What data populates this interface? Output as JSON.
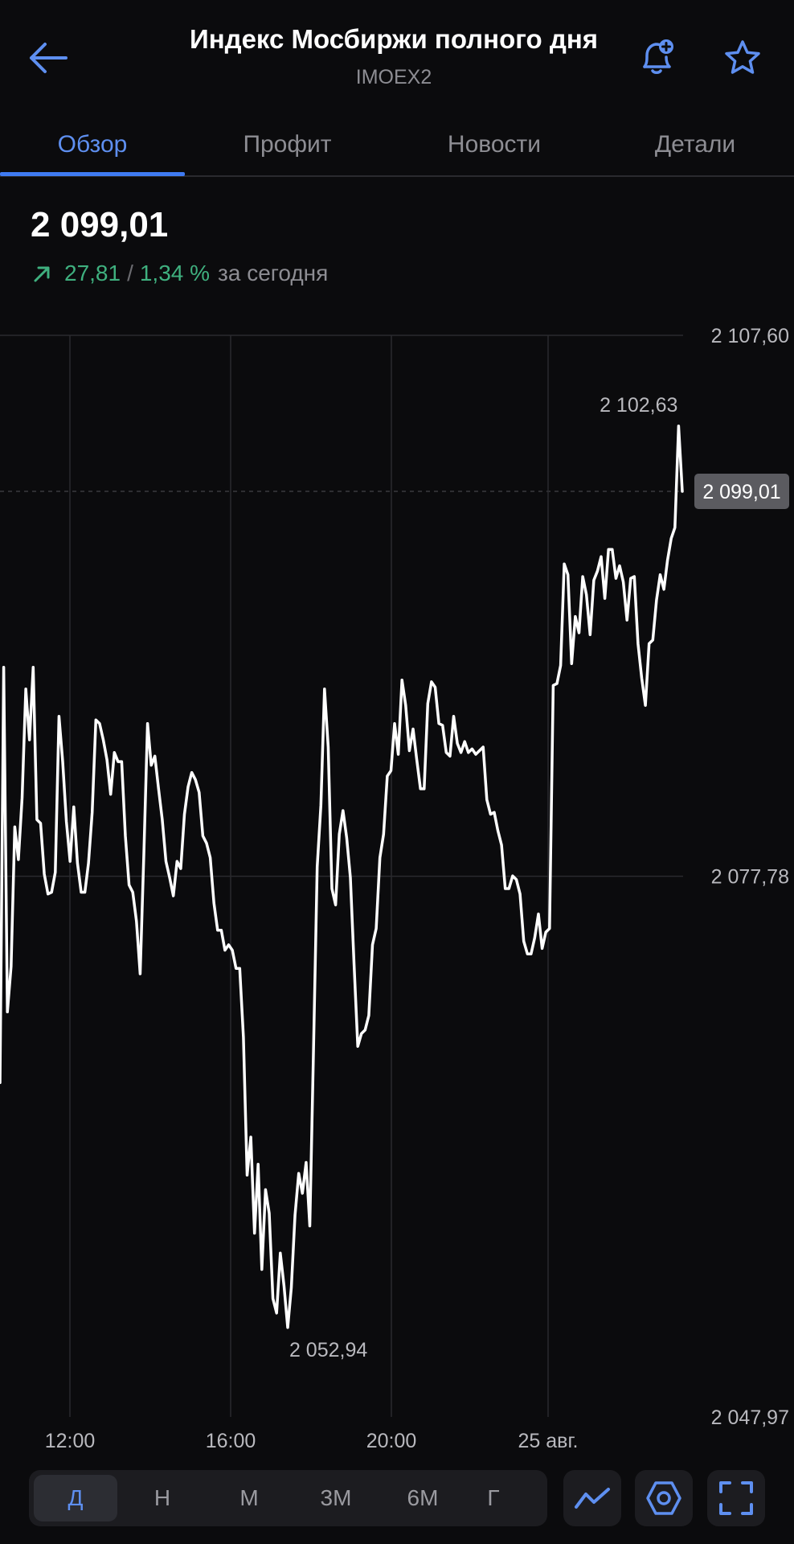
{
  "header": {
    "title": "Индекс Мосбиржи полного дня",
    "ticker": "IMOEX2",
    "icons": {
      "back": "arrow-left-icon",
      "alert": "bell-plus-icon",
      "favorite": "star-icon"
    }
  },
  "tabs": [
    {
      "label": "Обзор",
      "active": true
    },
    {
      "label": "Профит",
      "active": false
    },
    {
      "label": "Новости",
      "active": false
    },
    {
      "label": "Детали",
      "active": false
    }
  ],
  "quote": {
    "price": "2 099,01",
    "change_abs": "27,81",
    "separator": "/",
    "change_pct": "1,34 %",
    "change_label": "за сегодня",
    "direction_icon": "arrow-up-right-icon"
  },
  "colors": {
    "accent": "#3f7bf2",
    "positive": "#3fb07f",
    "line": "#ffffff",
    "background": "#0b0b0d"
  },
  "chart_data": {
    "type": "line",
    "title": "",
    "xlabel": "",
    "ylabel": "",
    "ylim": [
      2047.97,
      2107.6
    ],
    "y_ticks": [
      "2 107,60",
      "2 077,78",
      "2 047,97"
    ],
    "x_ticks": [
      "12:00",
      "16:00",
      "20:00",
      "25 авг."
    ],
    "annotations": {
      "max": "2 102,63",
      "min": "2 052,94",
      "current": "2 099,01"
    },
    "grid": true,
    "series": [
      {
        "values": [
          2066.4,
          2089.3,
          2070.3,
          2072.8,
          2080.5,
          2078.7,
          2082.1,
          2088.1,
          2085.3,
          2089.3,
          2080.9,
          2080.7,
          2077.9,
          2076.8,
          2076.9,
          2078.0,
          2086.6,
          2084.1,
          2080.8,
          2078.6,
          2081.6,
          2078.5,
          2076.9,
          2076.9,
          2078.5,
          2081.3,
          2086.4,
          2086.2,
          2085.3,
          2084.2,
          2082.3,
          2084.6,
          2084.1,
          2084.1,
          2080.0,
          2077.3,
          2076.9,
          2075.3,
          2072.4,
          2079.0,
          2086.2,
          2083.9,
          2084.4,
          2082.6,
          2080.9,
          2078.6,
          2077.7,
          2076.7,
          2078.6,
          2078.2,
          2081.2,
          2082.7,
          2083.5,
          2083.1,
          2082.4,
          2080.0,
          2079.6,
          2078.8,
          2076.3,
          2074.8,
          2074.8,
          2073.7,
          2074.0,
          2073.7,
          2072.7,
          2072.7,
          2068.9,
          2061.3,
          2063.4,
          2058.1,
          2061.9,
          2056.1,
          2060.5,
          2059.2,
          2054.5,
          2053.7,
          2057.0,
          2055.2,
          2052.9,
          2055.1,
          2059.1,
          2061.4,
          2060.3,
          2062.0,
          2058.5,
          2068.2,
          2078.3,
          2081.7,
          2088.1,
          2084.9,
          2077.1,
          2076.2,
          2080.1,
          2081.4,
          2079.9,
          2077.7,
          2072.9,
          2068.4,
          2069.1,
          2069.3,
          2070.1,
          2074.0,
          2074.9,
          2078.8,
          2080.1,
          2083.3,
          2083.6,
          2086.2,
          2084.5,
          2088.6,
          2087.2,
          2084.7,
          2085.9,
          2084.2,
          2082.6,
          2082.6,
          2087.3,
          2088.5,
          2088.2,
          2086.2,
          2086.1,
          2084.6,
          2084.4,
          2086.6,
          2085.1,
          2084.6,
          2085.2,
          2084.6,
          2084.8,
          2084.5,
          2084.7,
          2084.9,
          2082.0,
          2081.2,
          2081.3,
          2080.3,
          2079.5,
          2077.1,
          2077.1,
          2077.8,
          2077.6,
          2076.8,
          2074.2,
          2073.5,
          2073.5,
          2074.4,
          2075.7,
          2073.8,
          2074.7,
          2074.9,
          2088.3,
          2088.4,
          2089.4,
          2095.0,
          2094.4,
          2089.5,
          2092.1,
          2091.2,
          2094.3,
          2093.3,
          2091.1,
          2094.1,
          2094.6,
          2095.4,
          2093.1,
          2095.8,
          2095.8,
          2094.2,
          2094.9,
          2094.0,
          2091.9,
          2094.2,
          2094.3,
          2090.6,
          2088.7,
          2087.2,
          2090.6,
          2090.8,
          2093.0,
          2094.4,
          2093.6,
          2095.2,
          2096.4,
          2097.0,
          2102.6,
          2099.0
        ]
      }
    ]
  },
  "periods": [
    {
      "label": "Д",
      "active": true
    },
    {
      "label": "Н",
      "active": false
    },
    {
      "label": "М",
      "active": false
    },
    {
      "label": "3М",
      "active": false
    },
    {
      "label": "6М",
      "active": false
    },
    {
      "label": "Г",
      "active": false
    }
  ],
  "tools": {
    "chart_type": "line-chart-icon",
    "indicators": "hexagon-settings-icon",
    "fullscreen": "fullscreen-icon"
  }
}
